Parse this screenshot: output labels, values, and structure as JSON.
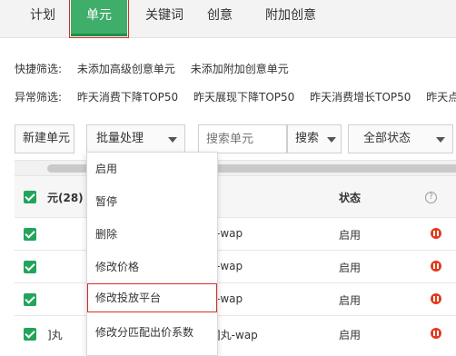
{
  "tabs": [
    {
      "label": "计划",
      "active": false
    },
    {
      "label": "单元",
      "active": true
    },
    {
      "label": "关键词",
      "active": false
    },
    {
      "label": "创意",
      "active": false
    },
    {
      "label": "附加创意",
      "active": false
    }
  ],
  "quick_filter": {
    "label": "快捷筛选:",
    "items": [
      "未添加高级创意单元",
      "未添加附加创意单元"
    ]
  },
  "anomaly_filter": {
    "label": "异常筛选:",
    "items": [
      "昨天消费下降TOP50",
      "昨天展现下降TOP50",
      "昨天消费增长TOP50",
      "昨天点"
    ]
  },
  "toolbar": {
    "new_unit_label": "新建单元",
    "batch_label": "批量处理",
    "search_placeholder": "搜索单元",
    "search_btn_label": "搜索",
    "status_filter_label": "全部状态"
  },
  "table": {
    "header": {
      "unit_col": "元(28)",
      "status_col": "状态",
      "help": "?"
    },
    "rows": [
      {
        "name": "",
        "name2": "-wap",
        "status": "启用"
      },
      {
        "name": "",
        "name2": "-wap",
        "status": "启用"
      },
      {
        "name": "",
        "name2": "-wap",
        "status": "启用"
      },
      {
        "name": "]丸",
        "name2": "]丸-wap",
        "status": "启用"
      }
    ]
  },
  "batch_menu": {
    "items": [
      "启用",
      "暂停",
      "删除",
      "修改价格",
      "修改投放平台",
      "修改分匹配出价系数"
    ],
    "highlighted_index": 4
  },
  "colors": {
    "accent": "#3fae6b",
    "status_paused_icon": "#e23a1e",
    "highlight_outline": "#d92b2b"
  }
}
